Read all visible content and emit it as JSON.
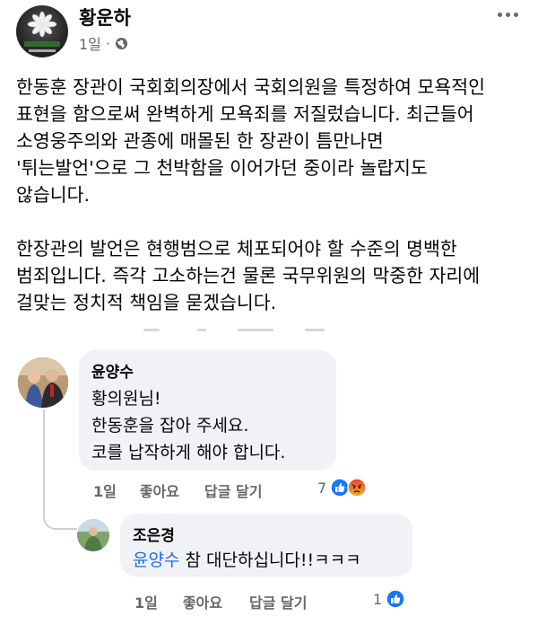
{
  "post": {
    "author": "황운하",
    "time": "1일",
    "separator": "·",
    "privacy_icon": "globe-icon",
    "more_icon": "more-horizontal-icon",
    "paragraphs": [
      "한동훈 장관이 국회회의장에서 국회의원을 특정하여 모욕적인\n표현을 함으로써 완벽하게 모욕죄를 저질렀습니다. 최근들어\n소영웅주의와 관종에 매몰된 한 장관이 틈만나면\n'튀는발언'으로 그 천박함을 이어가던 중이라 놀랍지도\n않습니다.",
      "한장관의 발언은 현행범으로 체포되어야 할 수준의 명백한\n범죄입니다. 즉각 고소하는건 물론 국무위원의 막중한 자리에\n걸맞는 정치적 책임을 묻겠습니다."
    ]
  },
  "comments": [
    {
      "name": "윤양수",
      "text": "황의원님!\n한동훈을 잡아  주세요.\n코를 납작하게 해야 합니다.",
      "time": "1일",
      "like_label": "좋아요",
      "reply_label": "답글 달기",
      "reaction_count": "7",
      "reactions": [
        "like-icon",
        "angry-icon"
      ],
      "colors": {
        "like": "#1877f2",
        "angry": "#e9710f"
      }
    },
    {
      "name": "조은경",
      "mention": "윤양수",
      "text": " 참 대단하십니다!!ㅋㅋㅋ",
      "time": "1일",
      "like_label": "좋아요",
      "reply_label": "답글 달기",
      "reaction_count": "1",
      "reactions": [
        "like-icon"
      ],
      "colors": {
        "like": "#1877f2"
      }
    }
  ]
}
